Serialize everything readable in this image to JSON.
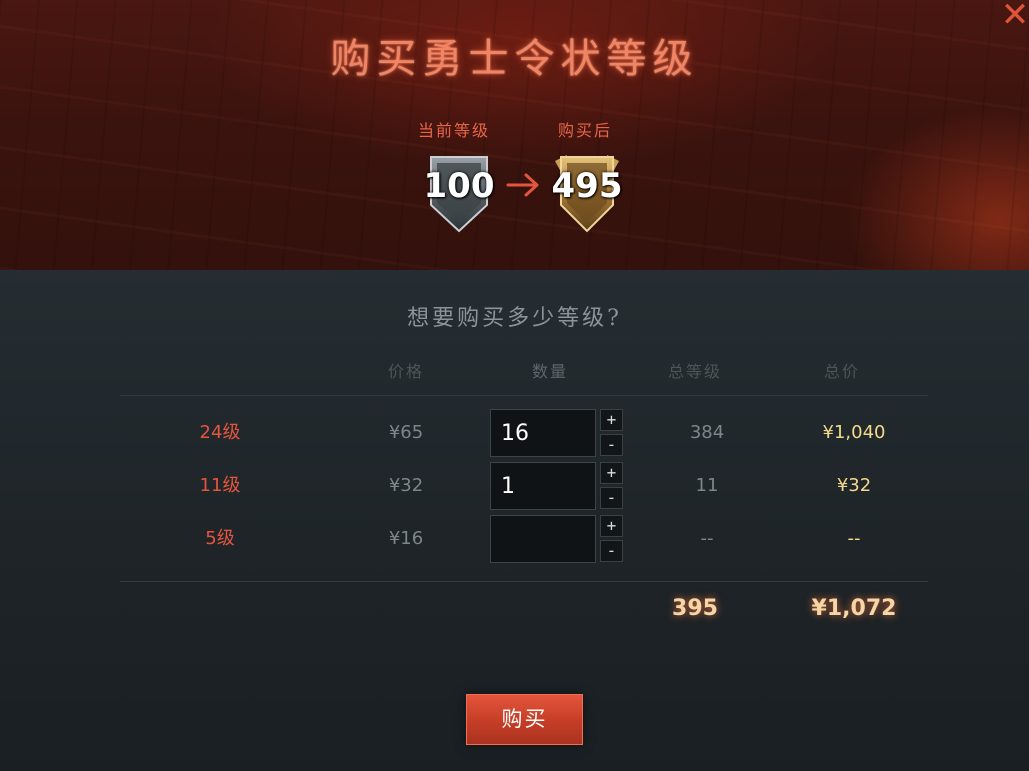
{
  "dialog": {
    "title": "购买勇士令状等级",
    "close_label": "✕"
  },
  "levels": {
    "current_label": "当前等级",
    "current_value": "100",
    "after_label": "购买后",
    "after_value": "495"
  },
  "question": "想要购买多少等级?",
  "columns": {
    "price": "价格",
    "quantity": "数量",
    "total_levels": "总等级",
    "total_price": "总价"
  },
  "rows": [
    {
      "level": "24级",
      "price": "¥65",
      "quantity": "16",
      "total_levels": "384",
      "total_price": "¥1,040"
    },
    {
      "level": "11级",
      "price": "¥32",
      "quantity": "1",
      "total_levels": "11",
      "total_price": "¥32"
    },
    {
      "level": "5级",
      "price": "¥16",
      "quantity": "",
      "total_levels": "--",
      "total_price": "--"
    }
  ],
  "stepper": {
    "plus": "+",
    "minus": "-"
  },
  "summary": {
    "total_levels": "395",
    "total_price": "¥1,072"
  },
  "buy_button": "购买",
  "colors": {
    "accent": "#e5553e",
    "gold": "#f3d98d",
    "muted": "#7d868b"
  }
}
